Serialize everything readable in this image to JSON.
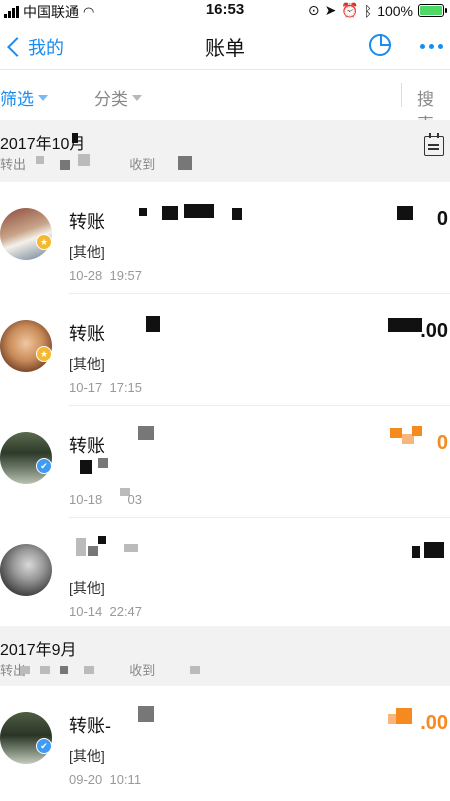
{
  "status_bar": {
    "carrier": "中国联通",
    "time": "16:53",
    "battery": "100%",
    "battery_level": 1.0
  },
  "nav": {
    "back_label": "我的",
    "title": "账单"
  },
  "filters": {
    "screen_label": "筛选",
    "category_label": "分类",
    "search_label": "搜索"
  },
  "months": [
    {
      "title": "2017年10月",
      "out_prefix": "转出",
      "in_prefix": "收到"
    },
    {
      "title": "2017年9月",
      "out_prefix": "转出",
      "in_prefix": "收到"
    }
  ],
  "transactions": [
    {
      "title": "转账",
      "tag": "[其他]",
      "date": "10-28",
      "time": "19:57",
      "amount": "0",
      "badge_icon": "star-badge-icon"
    },
    {
      "title": "转账",
      "tag": "[其他]",
      "date": "10-17",
      "time": "17:15",
      "amount": ".00",
      "badge_icon": "star-badge-icon"
    },
    {
      "title": "转账",
      "tag": "",
      "date": "10-18",
      "time": "03",
      "amount": "0",
      "badge_icon": "verified-badge-icon"
    },
    {
      "title": "",
      "tag": "[其他]",
      "date": "10-14",
      "time": "22:47",
      "amount": "",
      "badge_icon": ""
    },
    {
      "title": "转账-",
      "tag": "[其他]",
      "date": "09-20",
      "time": "10:11",
      "amount": ".00",
      "badge_icon": "verified-badge-icon"
    }
  ],
  "colors": {
    "accent": "#1a8cf0",
    "income": "#f58a1f",
    "section_bg": "#f2f2f2"
  }
}
